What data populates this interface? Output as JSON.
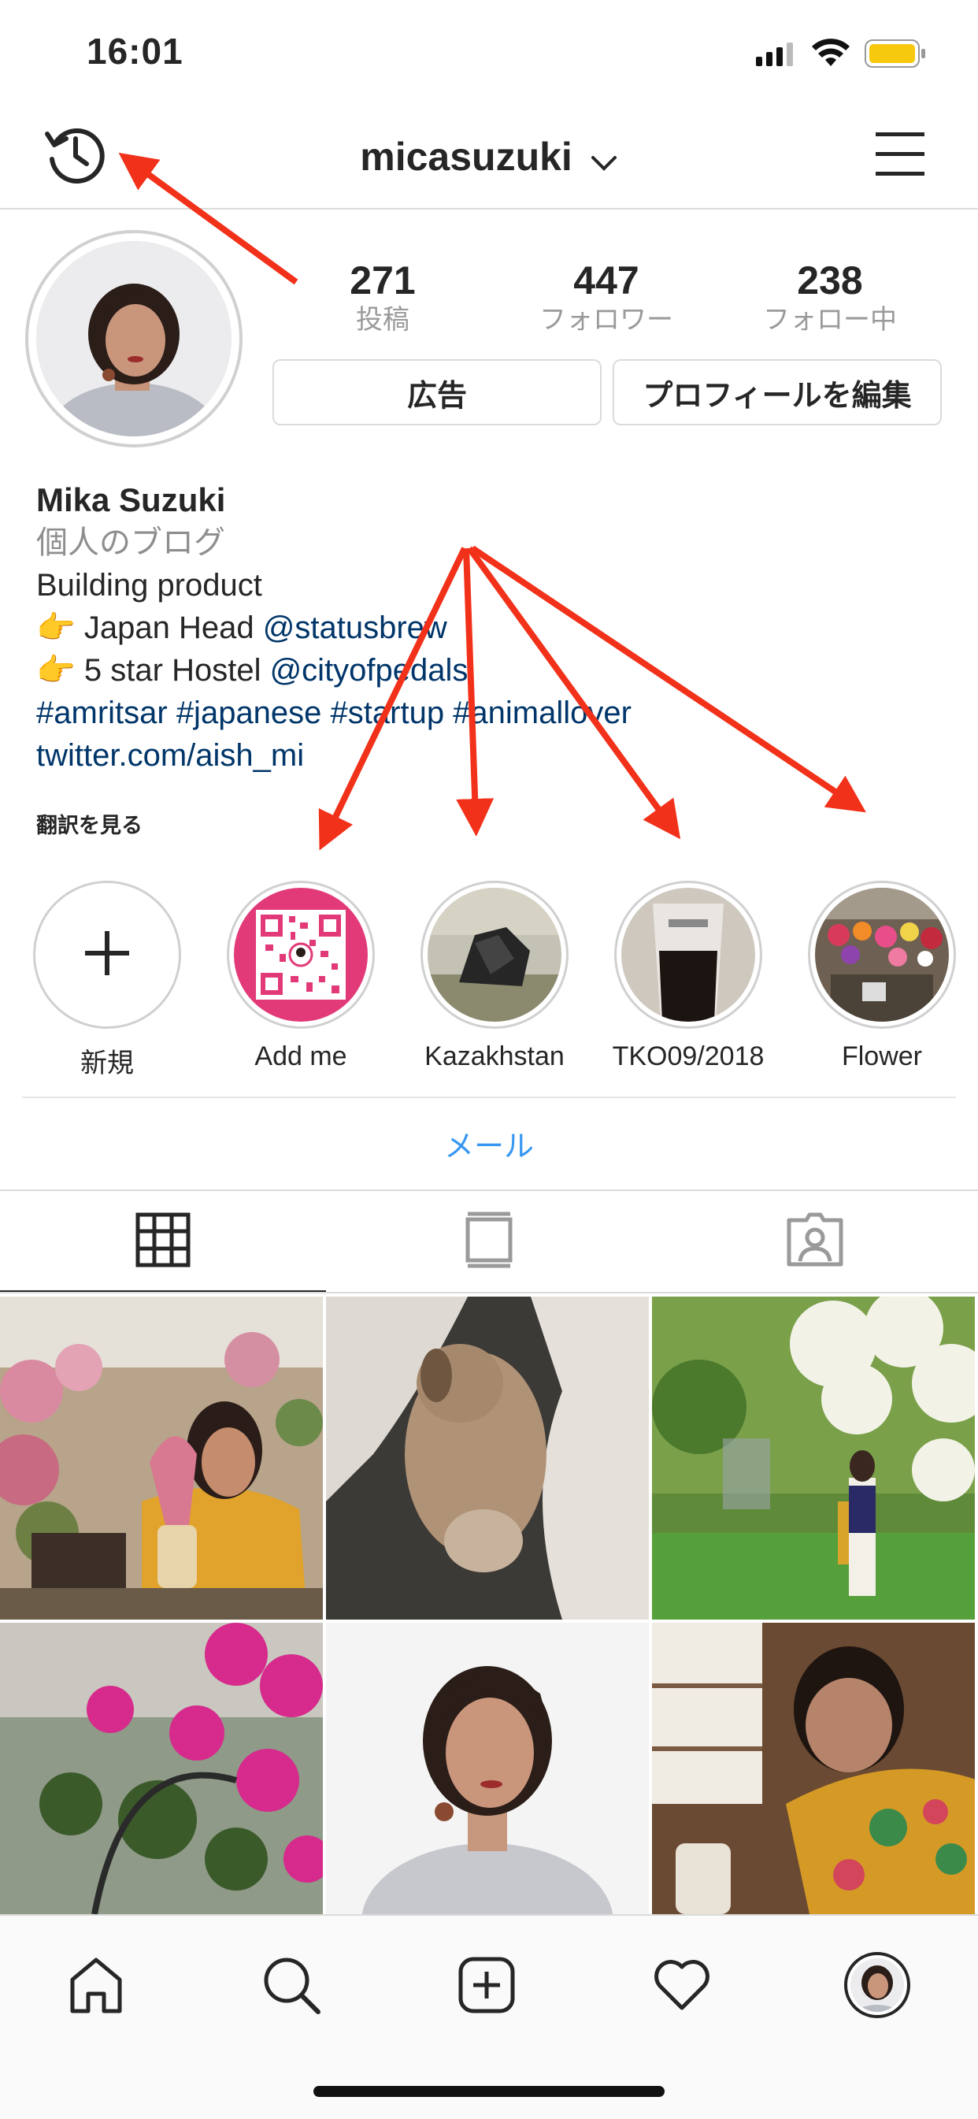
{
  "status_bar": {
    "time": "16:01"
  },
  "header": {
    "username": "micasuzuki",
    "history_icon": "history-icon",
    "menu_icon": "hamburger-menu-icon"
  },
  "profile": {
    "stats": [
      {
        "value": "271",
        "label": "投稿"
      },
      {
        "value": "447",
        "label": "フォロワー"
      },
      {
        "value": "238",
        "label": "フォロー中"
      }
    ],
    "promote_label": "広告",
    "edit_label": "プロフィールを編集",
    "name": "Mika Suzuki",
    "category": "個人のブログ",
    "bio_line1": "Building product",
    "bio_line2_text": " Japan Head  ",
    "bio_line2_mention": "@statusbrew",
    "bio_line3_text": " 5 star Hostel ",
    "bio_line3_mention": "@cityofpedals",
    "pointing_emoji": "👉",
    "hashtags": "#amritsar #japanese #startup #animallover",
    "website": "twitter.com/aish_mi",
    "translate_label": "翻訳を見る"
  },
  "highlights": [
    {
      "label": "新規"
    },
    {
      "label": "Add me"
    },
    {
      "label": "Kazakhstan"
    },
    {
      "label": "TKO09/2018"
    },
    {
      "label": "Flower"
    }
  ],
  "mail_label": "メール",
  "tabs": [
    "grid",
    "feed",
    "tagged"
  ],
  "colors": {
    "link": "#003569",
    "accent": "#3897f0",
    "arrow": "#f2311a"
  }
}
